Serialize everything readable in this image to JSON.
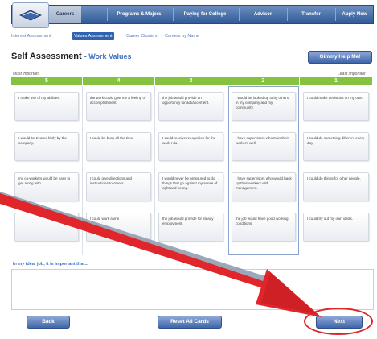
{
  "nav": {
    "tabs": [
      {
        "label": "Careers",
        "active": true
      },
      {
        "label": "Programs & Majors",
        "active": false
      },
      {
        "label": "Paying for College",
        "active": false
      },
      {
        "label": "Advisor",
        "active": false
      },
      {
        "label": "Transfer",
        "active": false
      },
      {
        "label": "Apply Now",
        "active": false
      }
    ]
  },
  "subnav": {
    "items": [
      {
        "label": "Interest Assessment",
        "active": false
      },
      {
        "label": "Values Assessment",
        "active": true
      },
      {
        "label": "Career Clusters",
        "active": false
      },
      {
        "label": "Careers by Name",
        "active": false
      }
    ]
  },
  "page": {
    "title": "Self Assessment",
    "subtitle": "Work Values",
    "help_label": "Gimmy Help Me!",
    "legend_left": "Most important",
    "legend_right": "Least important"
  },
  "columns": [
    {
      "rank": "5",
      "selected": false,
      "cards": [
        "I make use of my abilities.",
        "I would be treated fairly by the company.",
        "my co-workers would be easy to get along with.",
        ""
      ]
    },
    {
      "rank": "4",
      "selected": false,
      "cards": [
        "the work could give me a feeling of accomplishment.",
        "I could be busy all the time.",
        "I could give directions and instructions to others.",
        "I could work alone"
      ]
    },
    {
      "rank": "3",
      "selected": false,
      "cards": [
        "the job would provide an opportunity for advancement.",
        "I could receive recognition for the work I do.",
        "I would never be pressured to do things that go against my sense of right and wrong.",
        "the job would provide for steady employment."
      ]
    },
    {
      "rank": "2",
      "selected": true,
      "cards": [
        "I would be looked up to by others in my company and my community.",
        "I have supervisors who train their workers well.",
        "I have supervisors who would back up their workers with management.",
        "the job would have good working conditions."
      ]
    },
    {
      "rank": "1",
      "selected": false,
      "cards": [
        "I could make decisions on my own.",
        "I could do something different every day.",
        "I could do things for other people.",
        "I could try out my own ideas."
      ]
    }
  ],
  "ideal": {
    "label": "In my ideal job, it is important that..."
  },
  "buttons": {
    "back": "Back",
    "reset": "Reset All Cards",
    "next": "Next"
  },
  "colors": {
    "nav_blue": "#2d5a98",
    "column_header_green": "#84c23f",
    "annotation_red": "#e0262a"
  }
}
